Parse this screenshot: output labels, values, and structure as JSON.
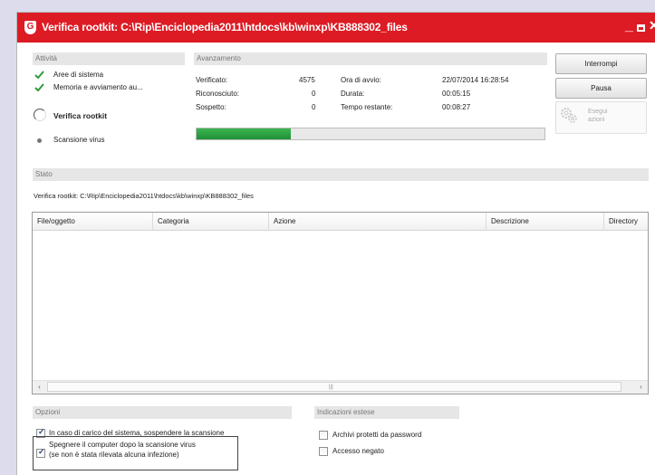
{
  "window": {
    "title": "Verifica rootkit: C:\\Rip\\Enciclopedia2011\\htdocs\\kb\\winxp\\KB888302_files",
    "logo_icon": "shield-icon",
    "accent_color": "#dd1b24"
  },
  "activity": {
    "header": "Attività",
    "items": [
      {
        "label": "Aree di sistema",
        "status": "done"
      },
      {
        "label": "Memoria e avviamento au...",
        "status": "done"
      },
      {
        "label": "Verifica rootkit",
        "status": "running"
      },
      {
        "label": "Scansione virus",
        "status": "pending"
      }
    ]
  },
  "progress": {
    "header": "Avanzamento",
    "checked_label": "Verificato:",
    "checked_value": "4575",
    "recognized_label": "Riconosciuto:",
    "recognized_value": "0",
    "suspect_label": "Sospetto:",
    "suspect_value": "0",
    "start_label": "Ora di avvio:",
    "start_value": "22/07/2014 16:28:54",
    "duration_label": "Durata:",
    "duration_value": "00:05:15",
    "remaining_label": "Tempo restante:",
    "remaining_value": "00:08:27",
    "fraction": 0.27,
    "bar_color": "#2ca444"
  },
  "buttons": {
    "stop": "Interrompi",
    "pause": "Pausa",
    "run_actions": "Eseguiazioni"
  },
  "status": {
    "header": "Stato",
    "text": "Verifica rootkit: C:\\Rip\\Enciclopedia2011\\htdocs\\kb\\winxp\\KB888302_files"
  },
  "table": {
    "columns": [
      "File/oggetto",
      "Categoria",
      "Azione",
      "Descrizione",
      "Directory"
    ],
    "rows": []
  },
  "options": {
    "header": "Opzioni",
    "items": [
      {
        "label": "In caso di carico del sistema, sospendere la scansione",
        "checked": true
      },
      {
        "label_line1": "Spegnere il computer dopo la scansione virus",
        "label_line2": "(se non è stata rilevata alcuna infezione)",
        "checked": true
      }
    ]
  },
  "extended": {
    "header": "Indicazioni estese",
    "items": [
      {
        "label": "Archivi protetti da password",
        "checked": false
      },
      {
        "label": "Accesso negato",
        "checked": false
      }
    ]
  }
}
